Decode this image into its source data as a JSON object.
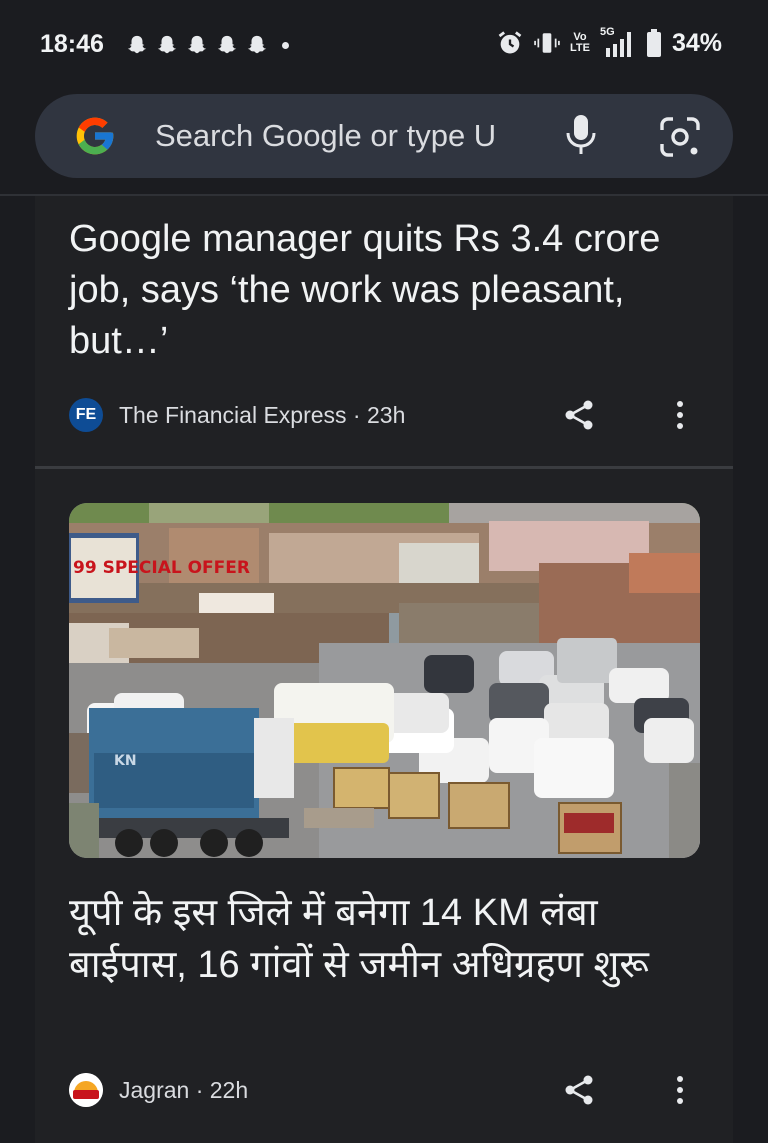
{
  "status_bar": {
    "time": "18:46",
    "network_top": "Vo",
    "network_bottom": "LTE",
    "signal_label": "5G",
    "battery": "34%",
    "icons": [
      "snapchat-icon",
      "alarm-icon",
      "vibrate-icon",
      "signal-icon",
      "battery-icon"
    ]
  },
  "search": {
    "placeholder": "Search Google or type U",
    "icons": [
      "google-logo",
      "mic-icon",
      "lens-icon"
    ]
  },
  "feed": {
    "cards": [
      {
        "headline": "Google manager quits Rs 3.4 crore job, says ‘the work was pleasant, but…’",
        "source_logo": "FE",
        "source": "The Financial Express · 23h"
      },
      {
        "headline": "यूपी के इस जिले में बनेगा 14 KM लंबा बाईपास, 16 गांवों से जमीन अधिग्रहण शुरू",
        "source": "Jagran · 22h",
        "image_sign_1": "99 SPECIAL OFFER",
        "image_truck_text": "KN"
      }
    ]
  },
  "colors": {
    "background": "#1b1c20",
    "card": "#202124",
    "search_bar": "#303540",
    "text": "#f1f3f4"
  }
}
